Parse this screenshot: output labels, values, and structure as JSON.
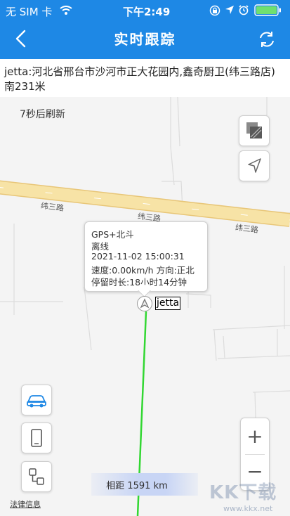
{
  "status_bar": {
    "carrier": "无 SIM 卡",
    "time": "下午2:49"
  },
  "header": {
    "title": "实时跟踪",
    "back_icon": "chevron-left-icon",
    "refresh_icon": "refresh-icon"
  },
  "address": "jetta:河北省邢台市沙河市正大花园内,鑫奇厨卫(纬三路店)南231米",
  "map": {
    "refresh_text": "7秒后刷新",
    "road_labels": [
      "纬三路",
      "纬三路",
      "纬三路"
    ],
    "popup": {
      "line1": "GPS+北斗",
      "line2": "离线",
      "line3": "2021-11-02 15:00:31",
      "line4": "速度:0.00km/h 方向:正北",
      "line5": "停留时长:18小时14分钟"
    },
    "vehicle_label": "jetta",
    "distance": "相距 1591 km",
    "legal_link": "法律信息",
    "zoom_in": "+",
    "zoom_out": "−"
  },
  "watermark": {
    "logo": "KK下载",
    "url": "www.kkx.net"
  },
  "colors": {
    "header_bg": "#1e88e5",
    "track_line": "#32d732",
    "road": "#f7e3a6",
    "road_border": "#e8c678"
  }
}
